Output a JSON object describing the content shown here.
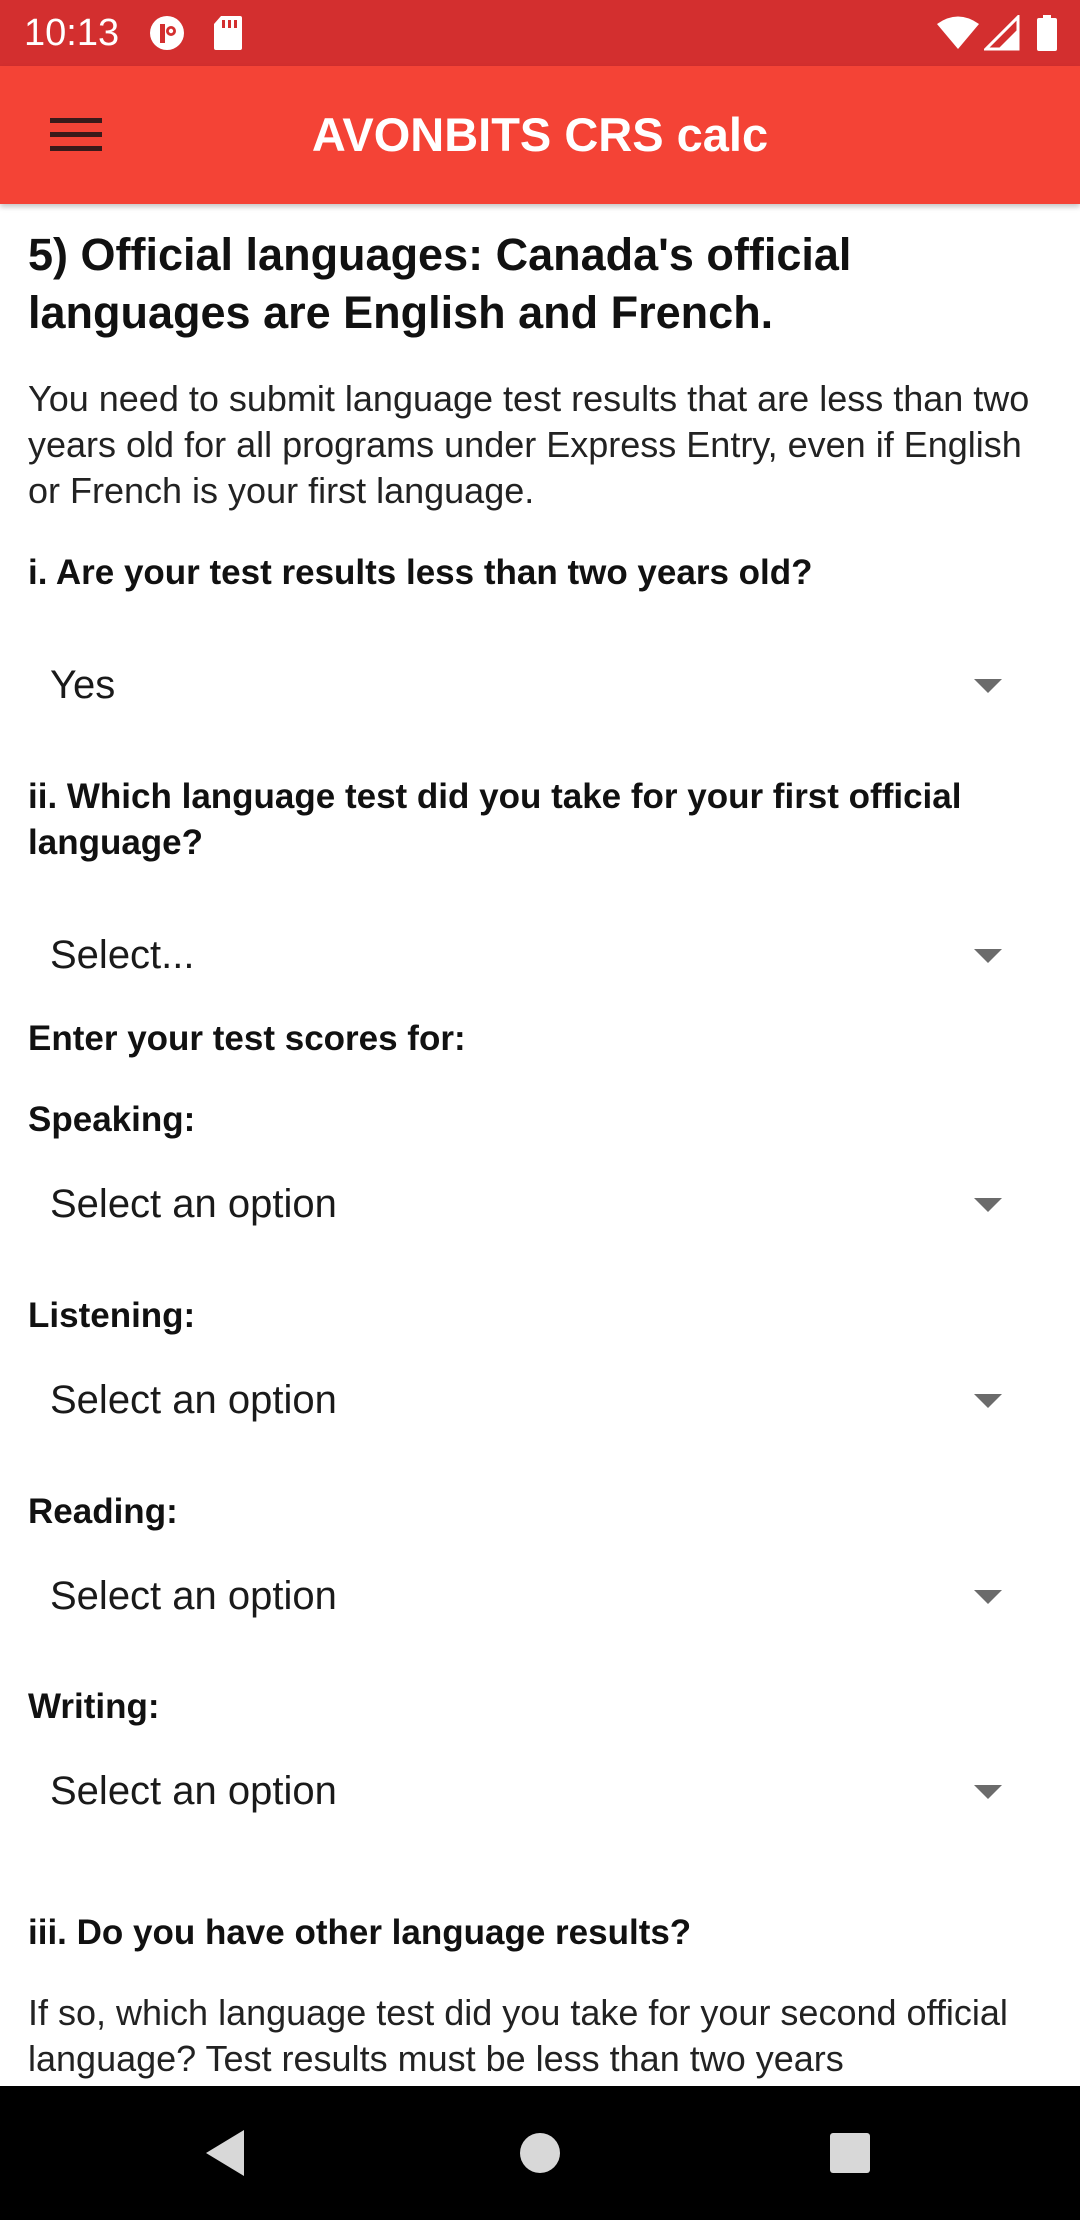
{
  "status_bar": {
    "time": "10:13",
    "left_icons": [
      "notification-icon",
      "sd-card-icon"
    ],
    "right_icons": [
      "wifi-icon",
      "cellular-signal-icon",
      "battery-icon"
    ]
  },
  "app_bar": {
    "title": "AVONBITS CRS calc",
    "menu_icon": "hamburger-menu-icon",
    "background_color": "#f44336",
    "status_color": "#d32f2f"
  },
  "section": {
    "title": "5) Official languages: Canada's official languages are English and French.",
    "intro": "You need to submit language test results that are less than two years old for all programs under Express Entry, even if English or French is your first language."
  },
  "questions": {
    "q1": {
      "label": "i. Are your test results less than two years old?",
      "value": "Yes"
    },
    "q2": {
      "label": "ii. Which language test did you take for your first official language?",
      "value": "Select..."
    },
    "scores": {
      "heading": "Enter your test scores for:",
      "speaking": {
        "label": "Speaking:",
        "value": "Select an option"
      },
      "listening": {
        "label": "Listening:",
        "value": "Select an option"
      },
      "reading": {
        "label": "Reading:",
        "value": "Select an option"
      },
      "writing": {
        "label": "Writing:",
        "value": "Select an option"
      }
    },
    "q3": {
      "label": "iii. Do you have other language results?",
      "description": "If so, which language test did you take for your second official language? Test results must be less than two years"
    }
  },
  "nav_bar": {
    "back_icon": "back-triangle-icon",
    "home_icon": "home-circle-icon",
    "recents_icon": "recents-square-icon"
  }
}
